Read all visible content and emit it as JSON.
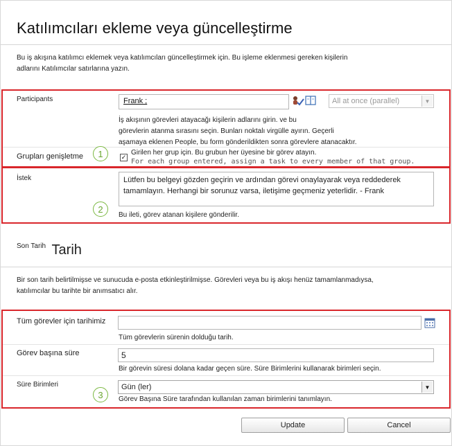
{
  "page_title": "Katılımcıları ekleme veya güncelleştirme",
  "intro": {
    "line1": "Bu iş akışına katılımcı eklemek veya katılımcıları güncelleştirmek için. Bu işleme eklenmesi gereken kişilerin",
    "line2": "adlarını Katılımcılar satırlarına yazın."
  },
  "participants": {
    "label": "Participants",
    "value": "Frank ;",
    "order_select": "All at once (parallel)",
    "help1": "İş akışının görevleri atayacağı kişilerin adlarını girin. ve bu",
    "help2": "görevlerin atanma sırasını seçin. Bunları noktalı virgülle ayırın. Geçerli",
    "help3": "aşamaya eklenen People, bu form gönderildikten sonra görevlere atanacaktır."
  },
  "expand_groups": {
    "label": "Grupları genişletme",
    "checked_glyph": "✓",
    "text_tr": "Girilen her grup için. Bu grubun her üyesine bir görev atayın.",
    "text_en": "For each group entered, assign a task to every member of that group."
  },
  "request": {
    "label": "İstek",
    "line1": "Lütfen bu belgeyi gözden geçirin ve ardından görevi onaylayarak veya reddederek",
    "line2": "tamamlayın. Herhangi bir sorunuz varsa, iletişime geçmeniz yeterlidir. - Frank",
    "help": "Bu ileti, görev atanan kişilere gönderilir."
  },
  "callouts": [
    "1",
    "2",
    "3"
  ],
  "due_section": {
    "small_heading": "Son Tarih",
    "big_heading": "Tarih",
    "intro1": "Bir son tarih belirtilmişse ve sunucuda e-posta etkinleştirilmişse. Görevleri veya bu iş akışı henüz tamamlanmadıysa,",
    "intro2": "katılımcılar bu tarihte bir anımsatıcı alır."
  },
  "due_all": {
    "label": "Tüm görevler için tarihimiz",
    "value": "",
    "help": "Tüm görevlerin sürenin dolduğu tarih."
  },
  "duration": {
    "label": "Görev başına süre",
    "value": "5",
    "help": "Bir görevin süresi dolana kadar geçen süre. Süre Birimlerini kullanarak birimleri seçin."
  },
  "units": {
    "label": "Süre Birimleri",
    "value": "Gün (ler)",
    "help": "Görev Başına Süre tarafından kullanılan zaman birimlerini tanımlayın."
  },
  "buttons": {
    "update": "Update",
    "cancel": "Cancel"
  },
  "colors": {
    "callout_border": "#d9262b",
    "callout_circle": "#7bb841"
  },
  "icons": [
    "check-names-icon",
    "address-book-icon",
    "dropdown-arrow-icon",
    "calendar-icon"
  ]
}
